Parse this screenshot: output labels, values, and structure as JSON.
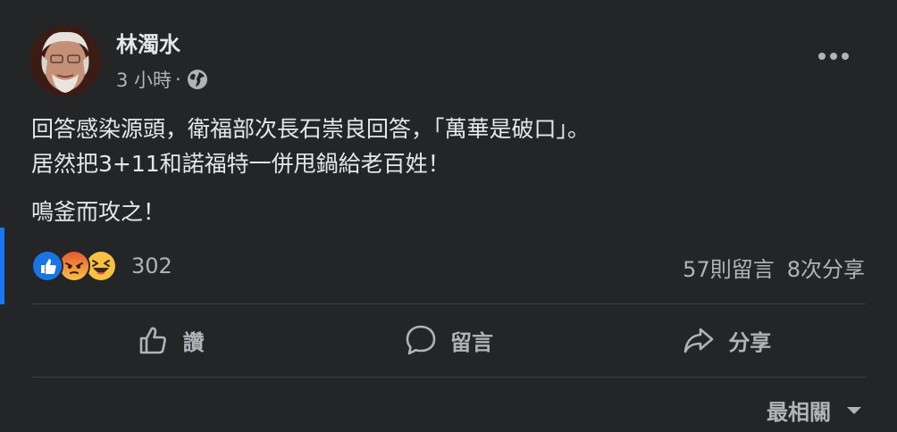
{
  "post": {
    "author": "林濁水",
    "time": "3 小時",
    "separator": "·",
    "privacy_icon": "globe-icon",
    "more_icon": "more-options-icon",
    "text_line1": "回答感染源頭，衛福部次長石崇良回答，「萬華是破口」。",
    "text_line2": "居然把3+11和諾福特一併甩鍋給老百姓！",
    "text_line3": "鳴釜而攻之！"
  },
  "reactions": {
    "icons": [
      "like-reaction-icon",
      "angry-reaction-icon",
      "haha-reaction-icon"
    ],
    "count": "302",
    "comments": "57則留言",
    "shares": "8次分享"
  },
  "actions": {
    "like": "讚",
    "comment": "留言",
    "share": "分享"
  },
  "sort": {
    "label": "最相關"
  },
  "colors": {
    "background": "#242526",
    "text_primary": "#e4e6eb",
    "text_secondary": "#b0b3b8",
    "accent": "#1877f2",
    "divider": "#3e4042"
  }
}
